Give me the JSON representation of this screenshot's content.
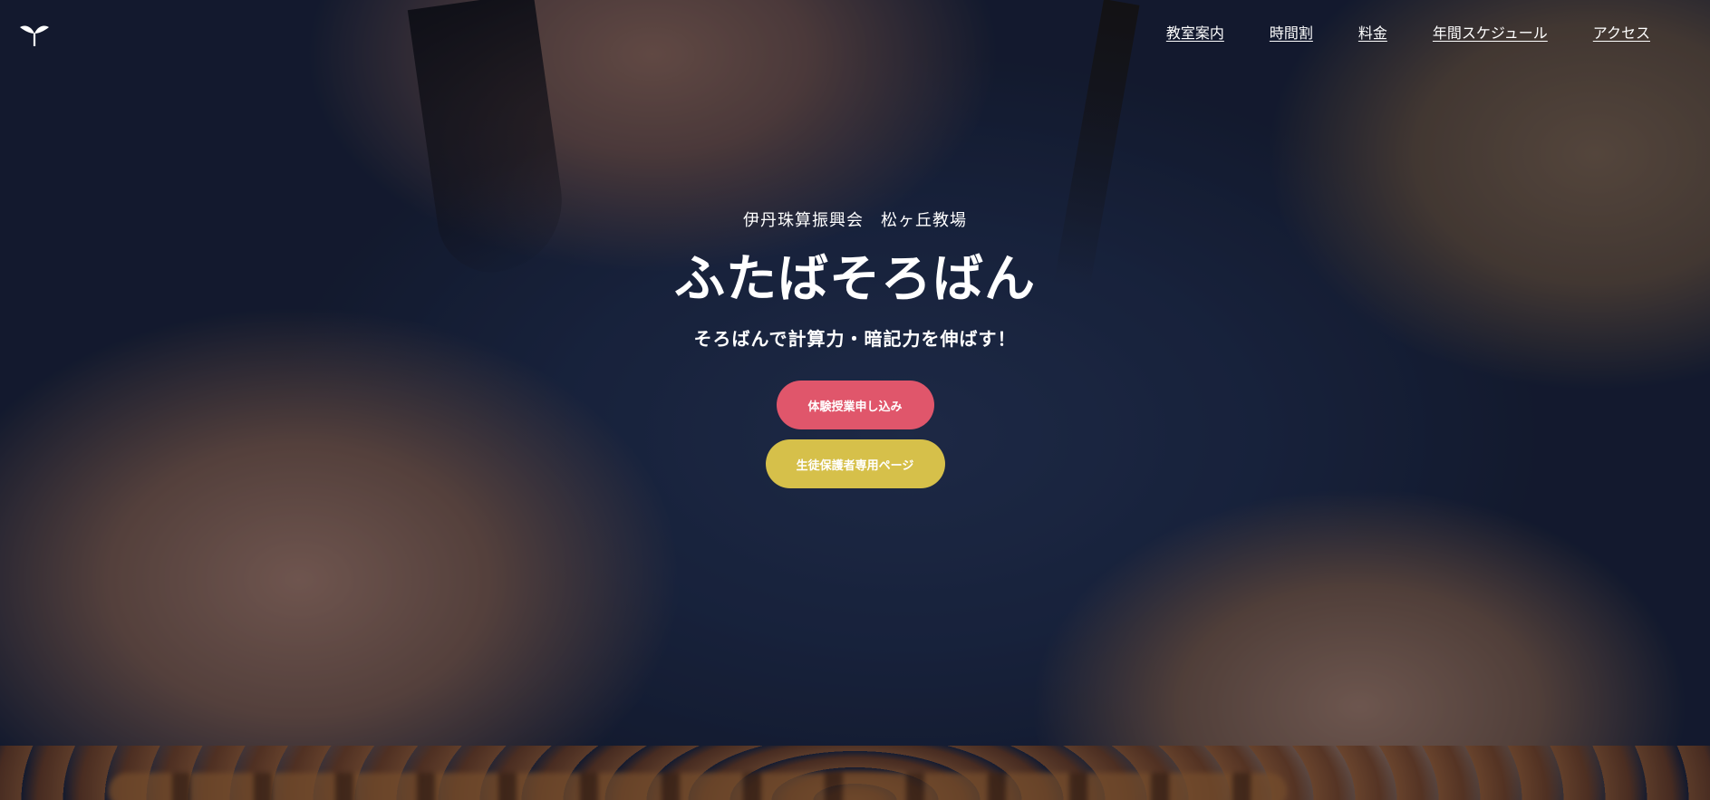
{
  "header": {
    "logo_icon": "sprout-icon",
    "nav": [
      {
        "label": "教室案内"
      },
      {
        "label": "時間割"
      },
      {
        "label": "料金"
      },
      {
        "label": "年間スケジュール"
      },
      {
        "label": "アクセス"
      }
    ]
  },
  "hero": {
    "subtitle": "伊丹珠算振興会　松ヶ丘教場",
    "title": "ふたばそろばん",
    "tagline": "そろばんで計算力・暗記力を伸ばす！",
    "buttons": {
      "trial": "体験授業申し込み",
      "members": "生徒保護者専用ページ"
    }
  },
  "colors": {
    "trial_button": "#e0566b",
    "members_button": "#d6c04a",
    "text": "#ffffff"
  }
}
